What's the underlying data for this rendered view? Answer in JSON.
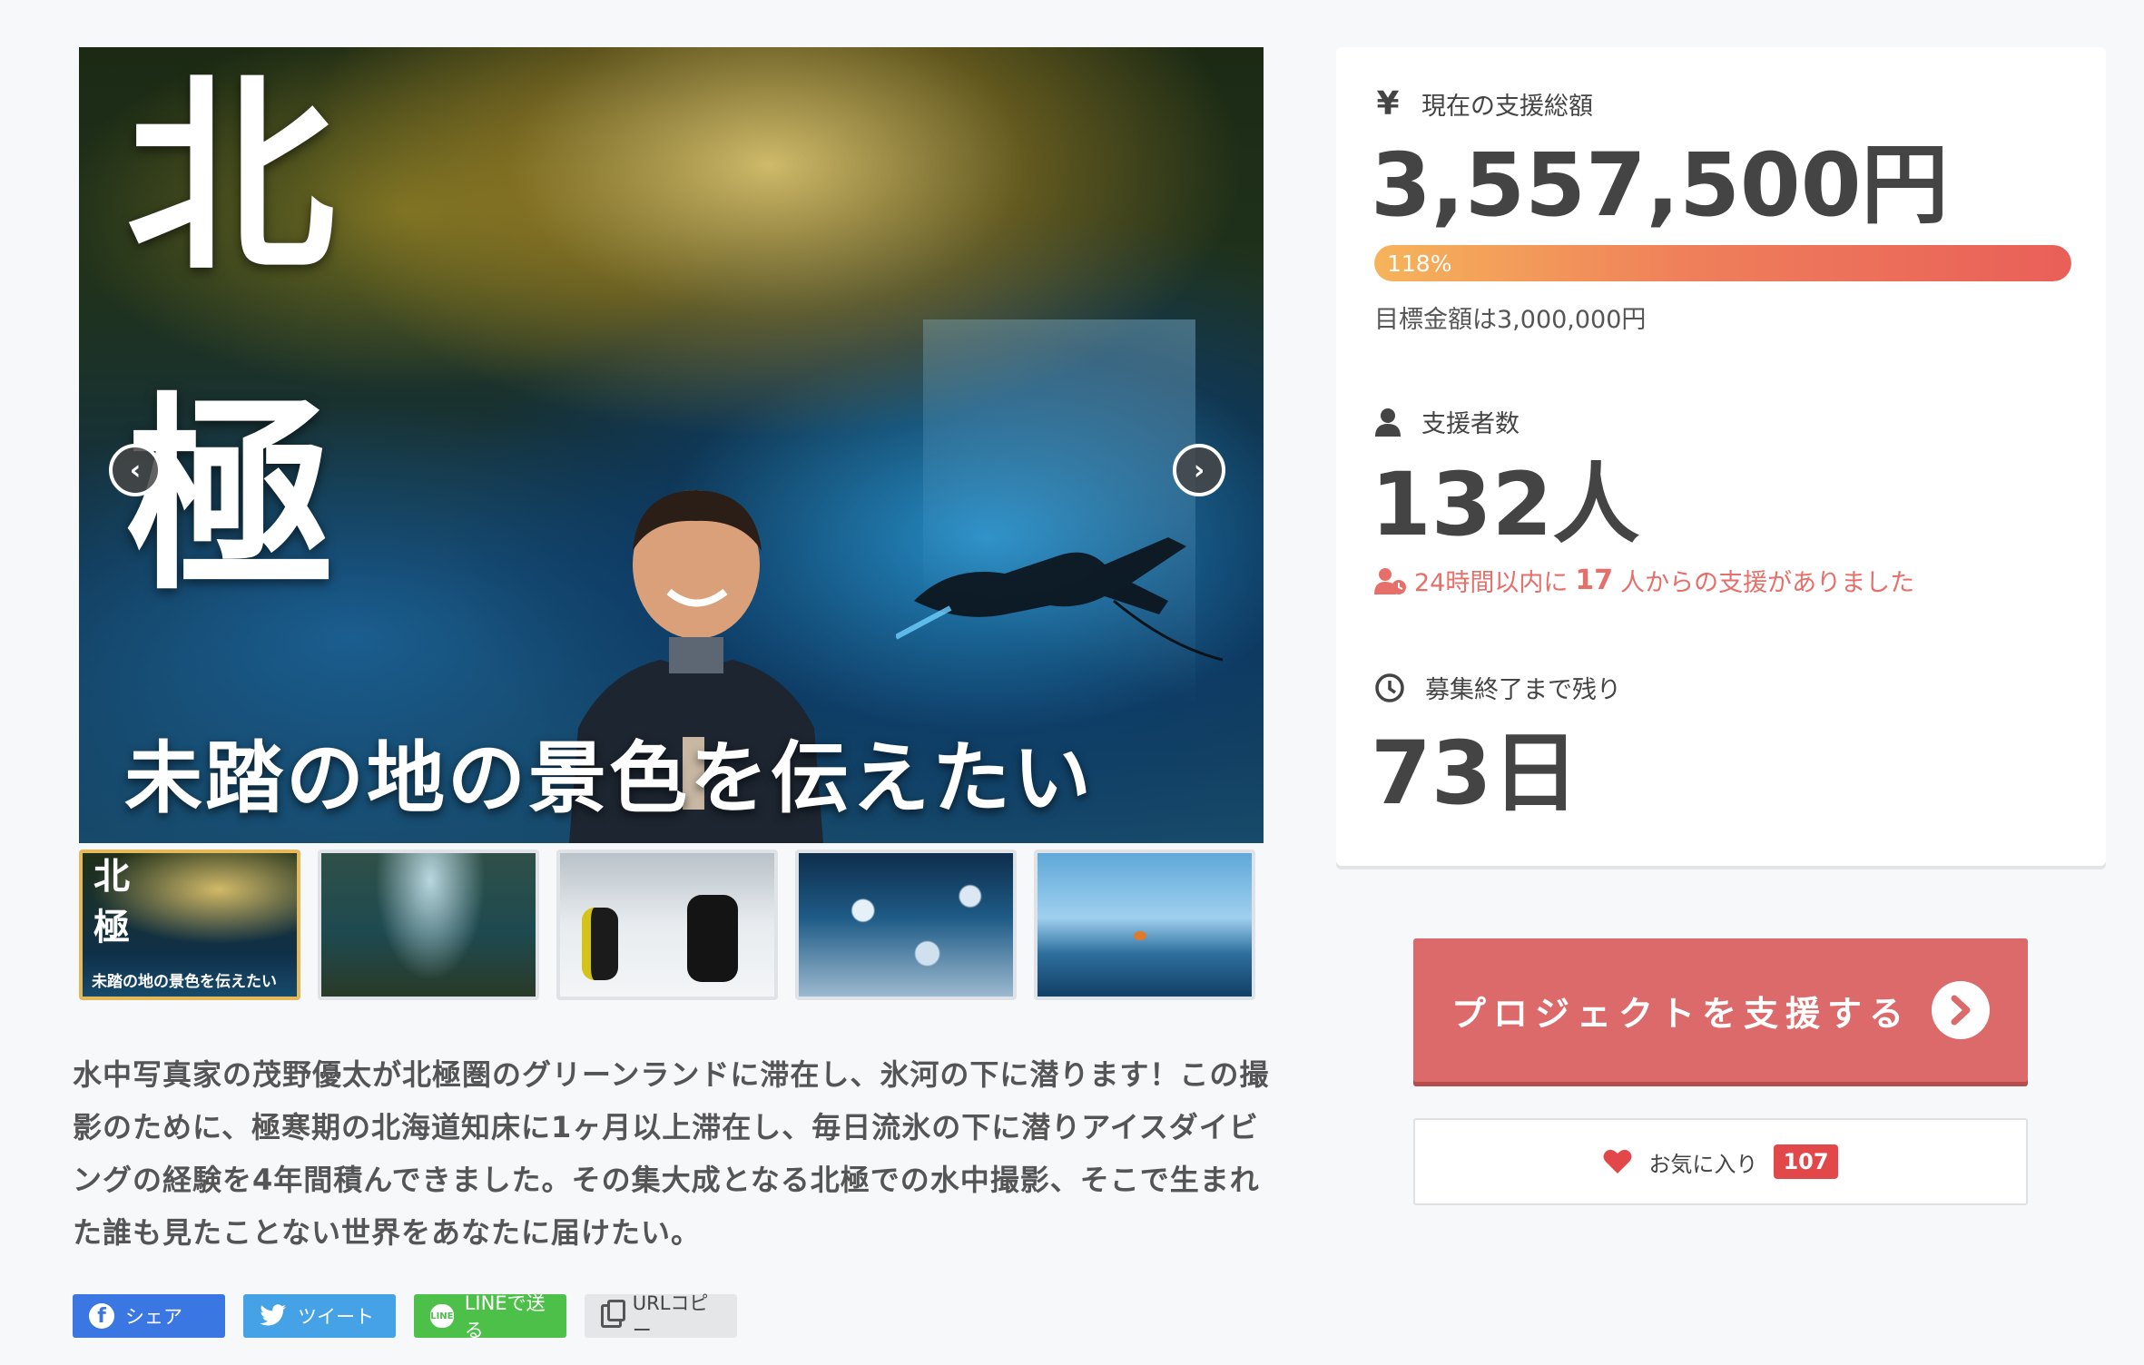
{
  "hero": {
    "title_char_1": "北",
    "title_char_2": "極",
    "subtitle": "未踏の地の景色を伝えたい",
    "prev_arrow": "‹",
    "next_arrow": "›"
  },
  "thumbnails": {
    "items": [
      {
        "title_char_1": "北",
        "title_char_2": "極",
        "subtitle": "未踏の地の景色を伝えたい",
        "active": true
      },
      {
        "active": false
      },
      {
        "active": false
      },
      {
        "active": false
      },
      {
        "active": false
      }
    ]
  },
  "description": "水中写真家の茂野優太が北極圏のグリーンランドに滞在し、氷河の下に潜ります！この撮影のために、極寒期の北海道知床に1ヶ月以上滞在し、毎日流氷の下に潜りアイスダイビングの経験を4年間積んできました。その集大成となる北極での水中撮影、そこで生まれた誰も見たことない世界をあなたに届けたい。",
  "share": {
    "facebook_label": "シェア",
    "twitter_label": "ツイート",
    "line_label": "LINEで送る",
    "line_icon_text": "LINE",
    "url_copy_label": "URLコピー"
  },
  "stats": {
    "total_label": "現在の支援総額",
    "total_icon": "¥",
    "total_value": "3,557,500円",
    "progress_label": "118%",
    "progress_fraction": 1.0,
    "goal_text": "目標金額は3,000,000円",
    "backers_label": "支援者数",
    "backers_value": "132人",
    "recent_prefix": "24時間以内に",
    "recent_count": "17",
    "recent_suffix": "人からの支援がありました",
    "remaining_label": "募集終了まで残り",
    "remaining_value": "73日"
  },
  "cta": {
    "support_label": "プロジェクトを支援する",
    "favorite_label": "お気に入り",
    "favorite_count": "107"
  },
  "colors": {
    "accent_red": "#dc6a6a",
    "recent_text": "#e66f6a",
    "progress_start": "#f6b45a",
    "progress_end": "#e95f59",
    "facebook": "#3b77e3",
    "twitter": "#46a2e6",
    "line": "#4cc048",
    "badge": "#e2474a"
  }
}
